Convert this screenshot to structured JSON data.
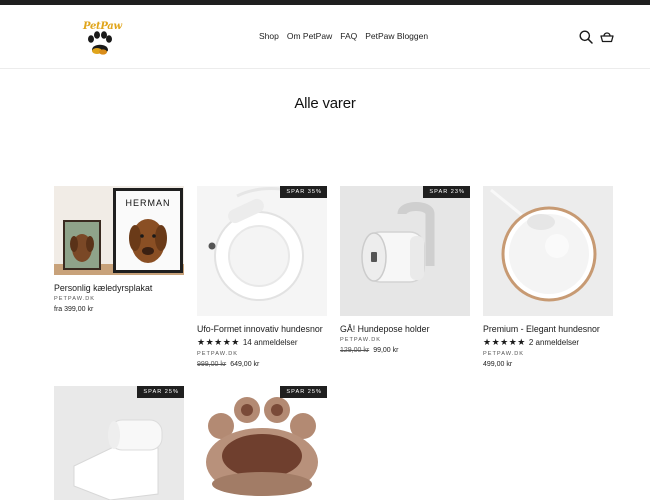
{
  "brand": {
    "logo_text": "PetPaw"
  },
  "nav": {
    "items": [
      "Shop",
      "Om PetPaw",
      "FAQ",
      "PetPaw Bloggen"
    ]
  },
  "icons": {
    "search": "search-icon",
    "cart": "basket-icon"
  },
  "page": {
    "title": "Alle varer"
  },
  "colors": {
    "badge_bg": "#1f1f1f",
    "topbar": "#1f1f1f",
    "logo_gold": "#e0a51b"
  },
  "products": [
    {
      "name": "Personlig kæledyrsplakat",
      "vendor": "PETPAW.DK",
      "badge": "",
      "price": "fra 399,00 kr",
      "poster_name": "HERMAN"
    },
    {
      "name": "Ufo-Formet innovativ hundesnor",
      "vendor": "PETPAW.DK",
      "badge": "SPAR 35%",
      "stars": "★★★★★",
      "reviews": "14 anmeldelser",
      "compare_price": "999,00 kr",
      "price": "649,00 kr"
    },
    {
      "name": "GÅ! Hundepose holder",
      "vendor": "PETPAW.DK",
      "badge": "SPAR 23%",
      "compare_price": "129,00 kr",
      "price": "99,00 kr"
    },
    {
      "name": "Premium - Elegant hundesnor",
      "vendor": "PETPAW.DK",
      "badge": "",
      "stars": "★★★★★",
      "reviews": "2 anmeldelser",
      "price": "499,00 kr"
    },
    {
      "badge": "SPAR 25%"
    },
    {
      "badge": "SPAR 25%"
    }
  ]
}
